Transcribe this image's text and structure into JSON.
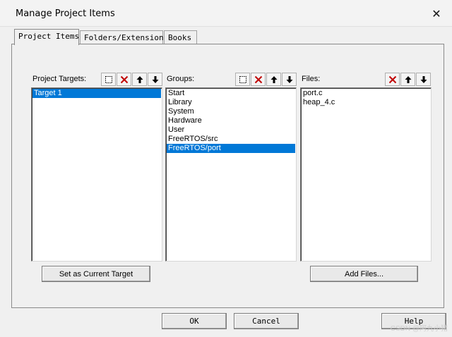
{
  "window": {
    "title": "Manage Project Items",
    "close_glyph": "✕"
  },
  "tabs": [
    {
      "label": "Project Items",
      "active": true
    },
    {
      "label": "Folders/Extensions",
      "active": false
    },
    {
      "label": "Books",
      "active": false
    }
  ],
  "targets": {
    "label": "Project Targets:",
    "items": [
      "Target 1"
    ],
    "selected_index": 0,
    "set_current_label": "Set as Current Target"
  },
  "groups": {
    "label": "Groups:",
    "items": [
      "Start",
      "Library",
      "System",
      "Hardware",
      "User",
      "FreeRTOS/src",
      "FreeRTOS/port"
    ],
    "selected_index": 6
  },
  "files": {
    "label": "Files:",
    "items": [
      "port.c",
      "heap_4.c"
    ],
    "add_files_label": "Add Files..."
  },
  "footer": {
    "ok_label": "OK",
    "cancel_label": "Cancel",
    "help_label": "Help"
  },
  "watermark": "CSDN @阿九小猪",
  "colors": {
    "selection": "#0078d7",
    "delete_red": "#c00000"
  },
  "icons": {
    "new": "new-item-icon",
    "delete": "delete-icon",
    "up": "move-up-icon",
    "down": "move-down-icon"
  }
}
